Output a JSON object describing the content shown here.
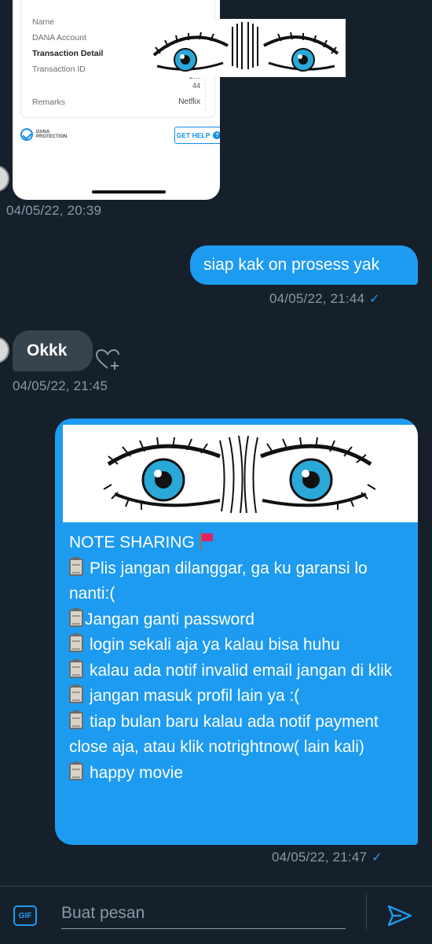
{
  "attachment": {
    "rows": {
      "name": "Name",
      "dana_account": "DANA Account",
      "transaction_detail": "Transaction Detail",
      "transaction_id": "Transaction ID",
      "transaction_id_value_line1": "2…",
      "transaction_id_value_line2": "44",
      "remarks": "Remarks",
      "remarks_value": "Netflix"
    },
    "protection_label_line1": "DANA",
    "protection_label_line2": "PROTECTION",
    "get_help": "GET HELP"
  },
  "messages": [
    {
      "type": "attachment",
      "direction": "in",
      "timestamp": "04/05/22, 20:39"
    },
    {
      "type": "text",
      "direction": "out",
      "text": "siap kak on prosess yak",
      "timestamp": "04/05/22, 21:44",
      "read": true
    },
    {
      "type": "text",
      "direction": "in",
      "text": "Okkk",
      "timestamp": "04/05/22, 21:45"
    },
    {
      "type": "note",
      "direction": "out",
      "title": "NOTE SHARING",
      "lines": [
        "Plis jangan dilanggar, ga ku garansi lo nanti:(",
        "Jangan ganti password",
        "login sekali aja ya kalau bisa huhu",
        "kalau ada notif invalid email jangan di klik",
        "jangan masuk profil lain ya :(",
        "tiap bulan baru kalau ada notif payment close aja, atau klik notrightnow( lain kali)",
        "happy movie"
      ],
      "timestamp": "04/05/22, 21:47",
      "read": true
    }
  ],
  "composer": {
    "gif_label": "GIF",
    "placeholder": "Buat pesan"
  },
  "colors": {
    "background": "#15202b",
    "accent": "#1d9bf0",
    "incoming_bubble": "#38444d",
    "muted_text": "#8899a6"
  }
}
